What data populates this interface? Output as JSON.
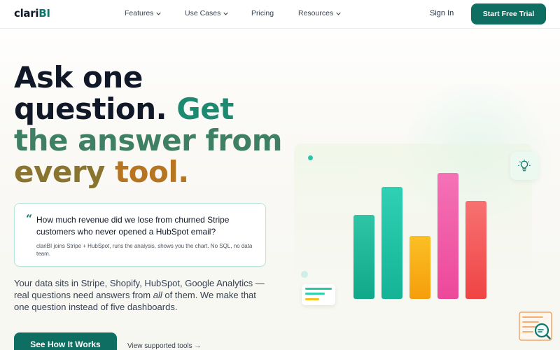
{
  "nav": {
    "logo_prefix": "clari",
    "logo_suffix": "BI",
    "links": [
      {
        "label": "Features",
        "dropdown": true
      },
      {
        "label": "Use Cases",
        "dropdown": true
      },
      {
        "label": "Pricing",
        "dropdown": false
      },
      {
        "label": "Resources",
        "dropdown": true
      }
    ],
    "signin": "Sign In",
    "trial": "Start Free Trial"
  },
  "hero": {
    "headline_dark_1": "Ask one",
    "headline_dark_2": "question.",
    "headline_green_2": "Get",
    "headline_line3": "the answer from",
    "headline_line4a": "every",
    "headline_line4b": "tool.",
    "quote_mark": "“",
    "quote": "How much revenue did we lose from churned Stripe customers who never opened a HubSpot email?",
    "quote_sub": "clariBI joins Stripe + HubSpot, runs the analysis, shows you the chart. No SQL, no data team.",
    "body_before": "Your data sits in Stripe, Shopify, HubSpot, Google Analytics — real questions need answers from ",
    "body_em": "all",
    "body_after": " of them. We make that one question instead of five dashboards.",
    "cta_primary": "See How It Works",
    "cta_secondary": "View supported tools →"
  },
  "illustration": {
    "bars": [
      {
        "value": 0.6,
        "color_top": "#2ec4a5",
        "color_bottom": "#11a88a"
      },
      {
        "value": 0.8,
        "color_top": "#2fd0b4",
        "color_bottom": "#14b395"
      },
      {
        "value": 0.45,
        "color_top": "#fbbf24",
        "color_bottom": "#f59e0b"
      },
      {
        "value": 0.9,
        "color_top": "#f472b6",
        "color_bottom": "#ec4899"
      },
      {
        "value": 0.7,
        "color_top": "#f87171",
        "color_bottom": "#ef4444"
      }
    ],
    "icons": {
      "idea": "lightbulb-icon",
      "search": "document-search-icon"
    }
  },
  "colors": {
    "brand": "#0f6e62",
    "accent_green": "#1b8a70",
    "accent_orange": "#b87521"
  }
}
